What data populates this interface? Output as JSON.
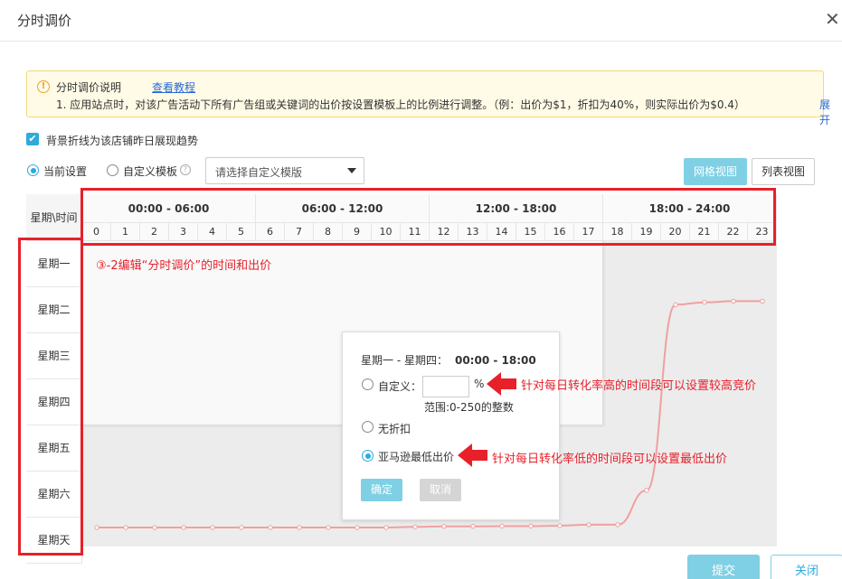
{
  "dialog": {
    "title": "分时调价",
    "close_glyph": "✕"
  },
  "notice": {
    "label": "分时调价说明",
    "link": "查看教程",
    "description": "1. 应用站点时，对该广告活动下所有广告组或关键词的出价按设置模板上的比例进行调整。（例：出价为$1，折扣为40%，则实际出价为$0.4）",
    "expand": "展开"
  },
  "trend_checkbox": {
    "label": "背景折线为该店铺昨日展现趋势",
    "checked": true
  },
  "settings": {
    "current_label": "当前设置",
    "custom_label": "自定义模板",
    "template_placeholder": "请选择自定义模版",
    "grid_view": "网格视图",
    "list_view": "列表视图"
  },
  "grid": {
    "corner": "星期\\时间",
    "ranges": [
      "00:00 - 06:00",
      "06:00 - 12:00",
      "12:00 - 18:00",
      "18:00 - 24:00"
    ],
    "hours": [
      "0",
      "1",
      "2",
      "3",
      "4",
      "5",
      "6",
      "7",
      "8",
      "9",
      "10",
      "11",
      "12",
      "13",
      "14",
      "15",
      "16",
      "17",
      "18",
      "19",
      "20",
      "21",
      "22",
      "23"
    ],
    "days": [
      "星期一",
      "星期二",
      "星期三",
      "星期四",
      "星期五",
      "星期六",
      "星期天"
    ],
    "selection": {
      "from_hour": 0,
      "to_hour": 18,
      "from_day": 0,
      "to_day": 3
    },
    "trend": [
      0,
      0,
      0,
      0,
      0,
      0,
      0,
      0,
      0,
      0,
      0,
      0.003,
      0.005,
      0.005,
      0.006,
      0.006,
      0.008,
      0.012,
      0.012,
      0.16,
      0.96,
      0.97,
      0.975,
      0.975
    ]
  },
  "popup": {
    "heading": "星期一 - 星期四：",
    "time": "00:00 - 18:00",
    "custom_label": "自定义：",
    "pct": "%",
    "range_hint": "范围:0-250的整数",
    "no_discount": "无折扣",
    "amazon_min": "亚马逊最低出价",
    "ok": "确定",
    "cancel": "取消"
  },
  "annotations": {
    "step": "③-2编辑“分时调价”的时间和出价",
    "high": "针对每日转化率高的时间段可以设置较高竞价",
    "low": "针对每日转化率低的时间段可以设置最低出价"
  },
  "footer": {
    "submit": "提交",
    "close": "关闭"
  },
  "colors": {
    "accent": "#7fd0e4",
    "annotation": "#e8202a",
    "trend_line": "#f0a0a0"
  }
}
